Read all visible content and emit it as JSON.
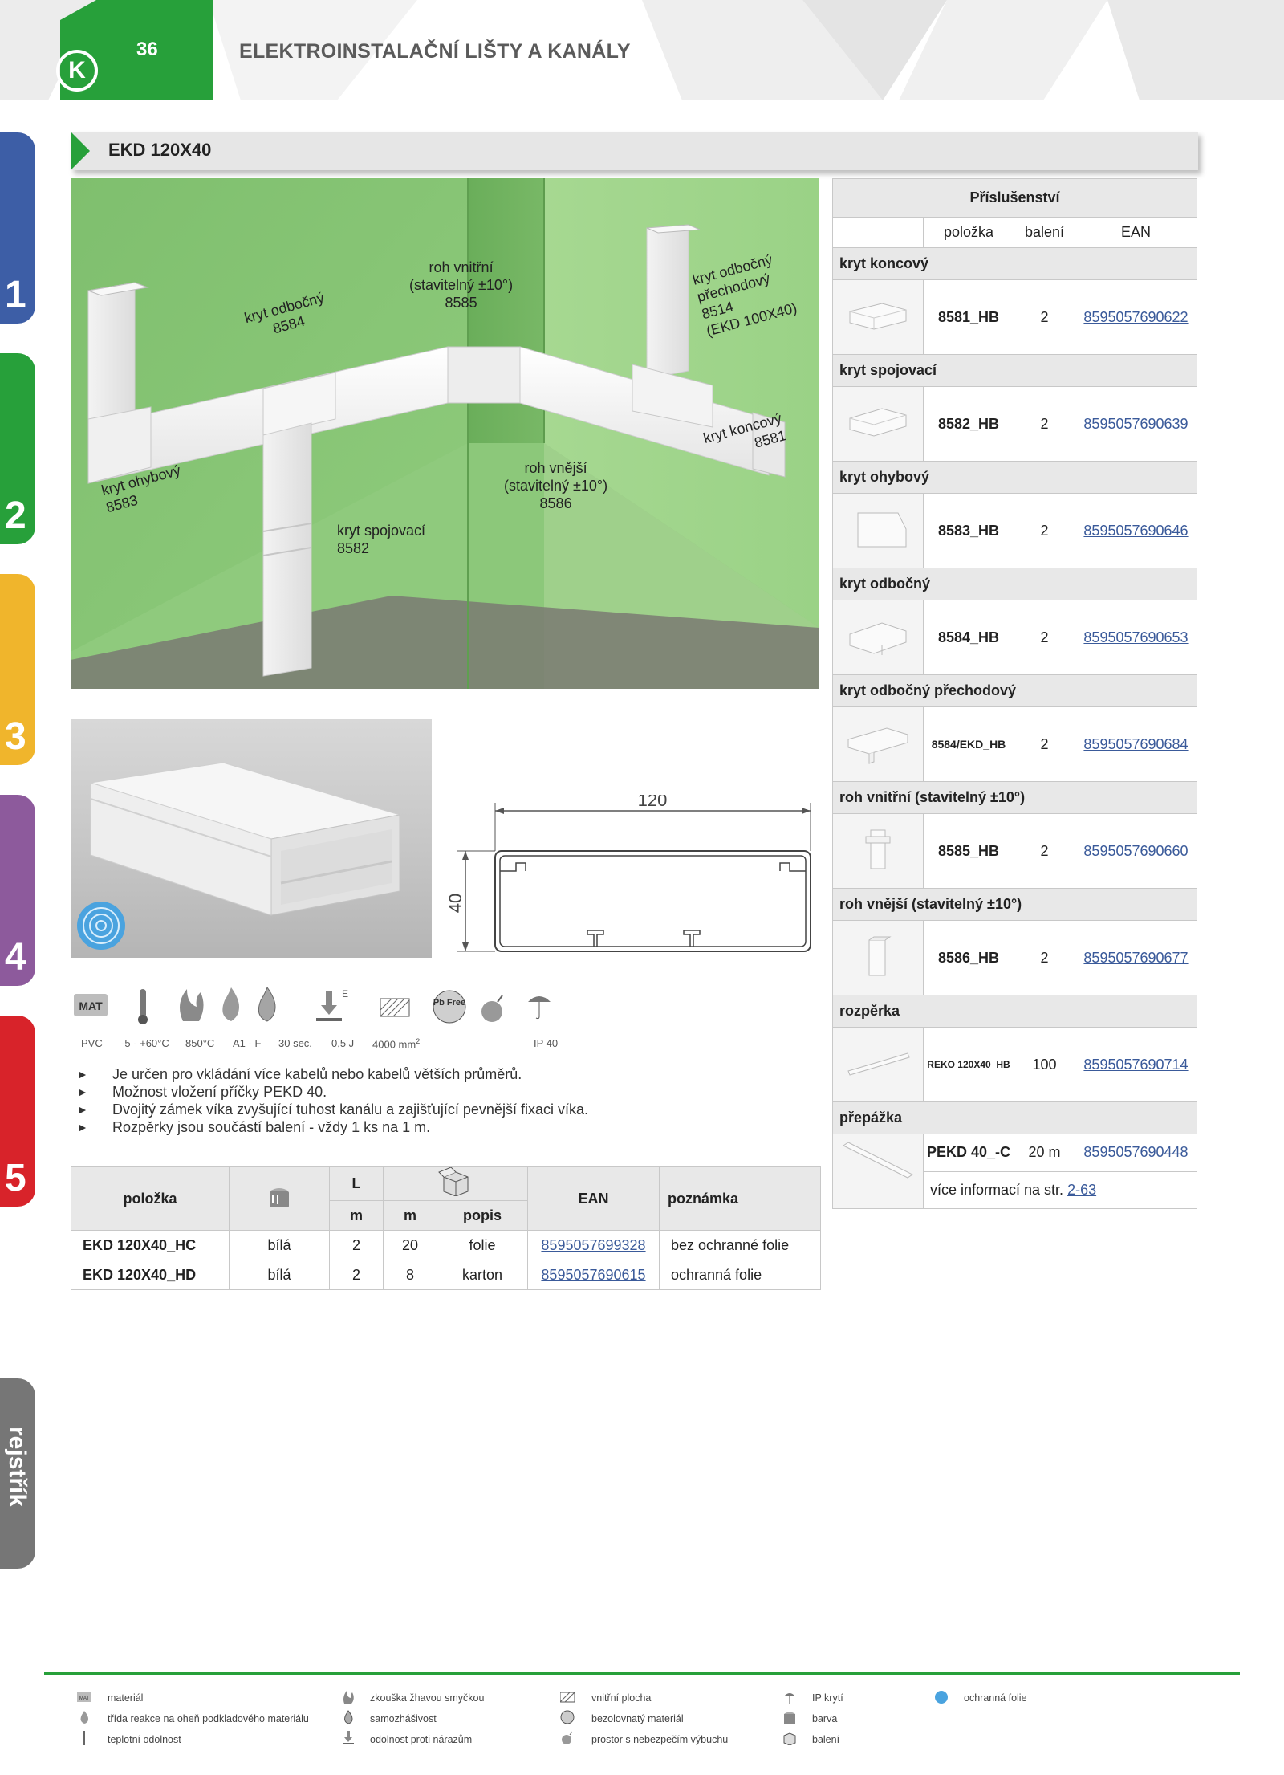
{
  "header": {
    "page_number": "36",
    "title": "ELEKTROINSTALAČNÍ LIŠTY A KANÁLY",
    "logo_letter": "K"
  },
  "side_tabs": [
    {
      "label": "1",
      "color": "#3d5ea6"
    },
    {
      "label": "2",
      "color": "#27a03a"
    },
    {
      "label": "3",
      "color": "#f0b52c"
    },
    {
      "label": "4",
      "color": "#8d5a9c"
    },
    {
      "label": "5",
      "color": "#d8232a"
    },
    {
      "label": "rejstřík",
      "color": "#767676"
    }
  ],
  "section_title": "EKD 120X40",
  "photo_labels": {
    "roh_vnitrni": [
      "roh vnitřní",
      "(stavitelný ±10°)",
      "8585"
    ],
    "kryt_odbocny_prechodovy": [
      "kryt odbočný",
      "přechodový",
      "8514",
      "(EKD 100X40)"
    ],
    "kryt_odbocny": [
      "kryt odbočný",
      "8584"
    ],
    "kryt_ohybovy": [
      "kryt ohybový",
      "8583"
    ],
    "kryt_koncovy": [
      "kryt koncový",
      "8581"
    ],
    "roh_vnejsi": [
      "roh vnější",
      "(stavitelný ±10°)",
      "8586"
    ],
    "kryt_spojovaci": [
      "kryt spojovací",
      "8582"
    ]
  },
  "dimensions": {
    "width": "120",
    "height": "40"
  },
  "icon_labels": {
    "material": "PVC",
    "temperature": "-5 - +60°C",
    "glow_wire": "850°C",
    "flame_class": "A1 - F",
    "self_extinguishing": "30 sec.",
    "impact": "0,5 J",
    "inner_area": "4000 mm",
    "inner_area_sup": "2",
    "ip": "IP 40",
    "mat_badge": "MAT",
    "pb_free": "Pb Free",
    "impact_letter": "E"
  },
  "bullets": [
    "Je určen pro vkládání více kabelů nebo kabelů větších průměrů.",
    "Možnost vložení příčky PEKD 40.",
    "Dvojitý zámek víka zvyšující tuhost kanálu a zajišťující pevnější fixaci víka.",
    "Rozpěrky jsou součástí balení - vždy 1 ks na 1 m."
  ],
  "main_table": {
    "headers": {
      "polozka": "položka",
      "L": "L",
      "ean": "EAN",
      "poznamka": "poznámka",
      "m1": "m",
      "m2": "m",
      "popis": "popis"
    },
    "rows": [
      {
        "polozka": "EKD 120X40_HC",
        "barva": "bílá",
        "L": "2",
        "baleni": "20",
        "popis": "folie",
        "ean": "8595057699328",
        "poznamka": "bez ochranné folie"
      },
      {
        "polozka": "EKD 120X40_HD",
        "barva": "bílá",
        "L": "2",
        "baleni": "8",
        "popis": "karton",
        "ean": "8595057690615",
        "poznamka": "ochranná folie"
      }
    ]
  },
  "accessories": {
    "title": "Příslušenství",
    "col_polozka": "položka",
    "col_baleni": "balení",
    "col_ean": "EAN",
    "items": [
      {
        "category": "kryt koncový",
        "code": "8581_HB",
        "baleni": "2",
        "ean": "8595057690622"
      },
      {
        "category": "kryt spojovací",
        "code": "8582_HB",
        "baleni": "2",
        "ean": "8595057690639"
      },
      {
        "category": "kryt ohybový",
        "code": "8583_HB",
        "baleni": "2",
        "ean": "8595057690646"
      },
      {
        "category": "kryt odbočný",
        "code": "8584_HB",
        "baleni": "2",
        "ean": "8595057690653"
      },
      {
        "category": "kryt odbočný přechodový",
        "code": "8584/EKD_HB",
        "baleni": "2",
        "ean": "8595057690684"
      },
      {
        "category": "roh vnitřní (stavitelný ±10°)",
        "code": "8585_HB",
        "baleni": "2",
        "ean": "8595057690660"
      },
      {
        "category": "roh vnější (stavitelný ±10°)",
        "code": "8586_HB",
        "baleni": "2",
        "ean": "8595057690677"
      },
      {
        "category": "rozpěrka",
        "code": "REKO 120X40_HB",
        "baleni": "100",
        "ean": "8595057690714"
      },
      {
        "category": "přepážka",
        "code": "PEKD 40_-C",
        "baleni": "20 m",
        "ean": "8595057690448"
      }
    ],
    "more_info": "více informací na str.",
    "more_info_link": "2-63"
  },
  "legend": {
    "col1": [
      "materiál",
      "třída reakce na oheň podkladového materiálu",
      "teplotní odolnost"
    ],
    "col2": [
      "zkouška žhavou smyčkou",
      "samozhášivost",
      "odolnost proti nárazům"
    ],
    "col3": [
      "vnitřní plocha",
      "bezolovnatý materiál",
      "prostor s nebezpečím výbuchu"
    ],
    "col4": [
      "IP krytí",
      "barva",
      "balení"
    ],
    "col5": [
      "ochranná folie"
    ],
    "mat_badge": "MAT"
  }
}
